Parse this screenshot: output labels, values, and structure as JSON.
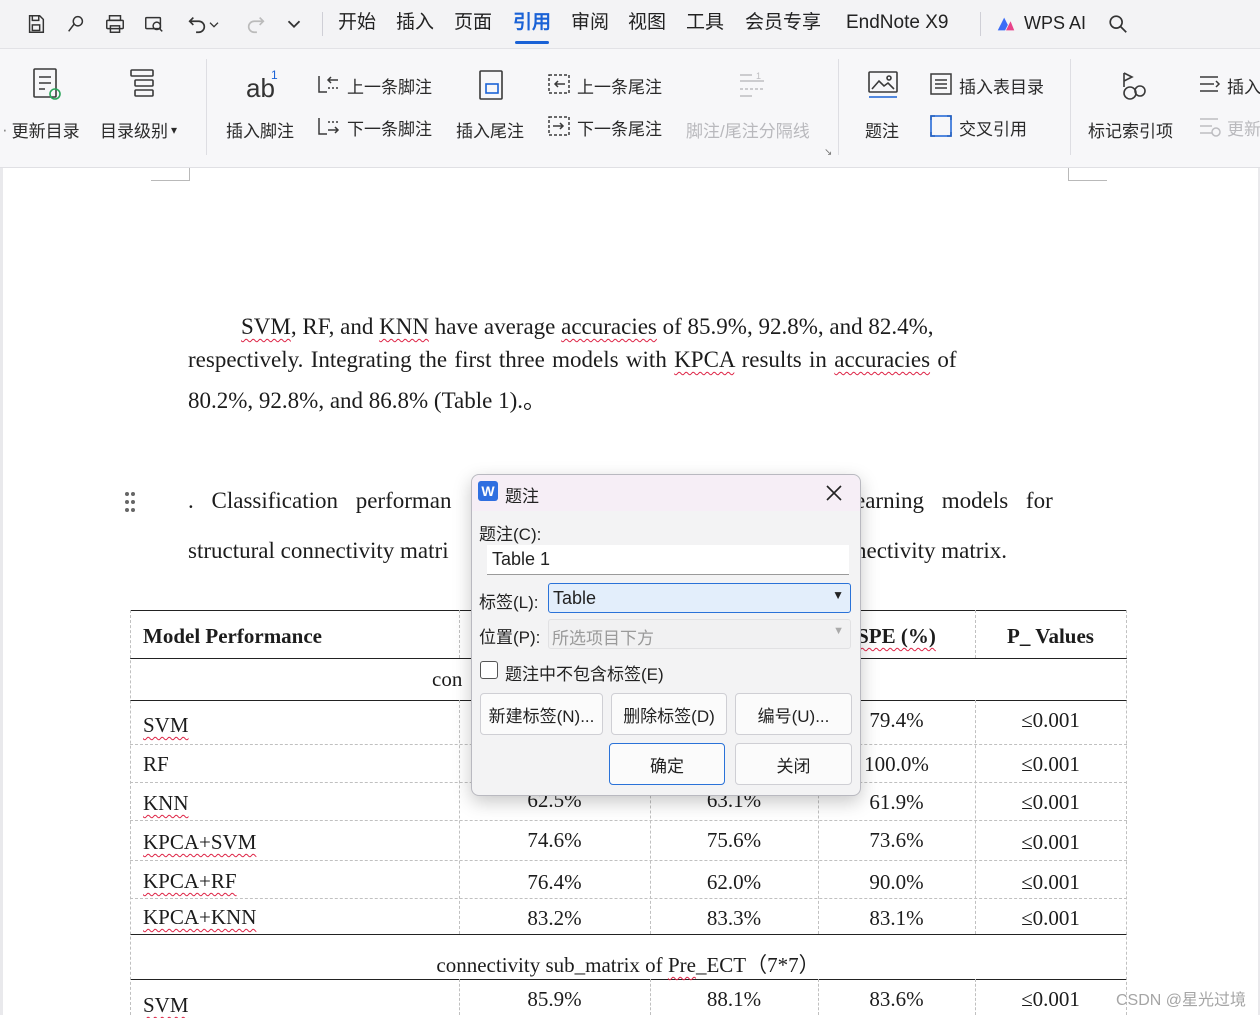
{
  "menu": {
    "tabs": [
      "开始",
      "插入",
      "页面",
      "引用",
      "审阅",
      "视图",
      "工具",
      "会员专享",
      "EndNote X9"
    ],
    "active": "引用",
    "wps_ai": "WPS AI"
  },
  "ribbon": {
    "update_toc": "更新目录",
    "toc_level": "目录级别",
    "insert_footnote": "插入脚注",
    "prev_footnote": "上一条脚注",
    "next_footnote": "下一条脚注",
    "insert_endnote": "插入尾注",
    "prev_endnote": "上一条尾注",
    "next_endnote": "下一条尾注",
    "separator": "脚注/尾注分隔线",
    "caption": "题注",
    "insert_table_toc": "插入表目录",
    "cross_ref": "交叉引用",
    "mark_index": "标记索引项",
    "insert_partial": "插入",
    "update_partial": "更新"
  },
  "document": {
    "para1_line1": [
      "SVM",
      ", RF, and ",
      "KNN",
      " have average ",
      "accuracies",
      " of 85.9%, 92.8%, and 82.4%,"
    ],
    "para1_line2": [
      "respectively. Integrating the first three models with ",
      "KPCA",
      " results in ",
      "accuracies",
      " of"
    ],
    "para1_line3": "80.2%, 92.8%, and 86.8% (Table 1).。",
    "caption_left1": ". Classification performan",
    "caption_right1": "earning models for",
    "caption_left2": "structural connectivity matri",
    "caption_right2": "nectivity matrix."
  },
  "table": {
    "headers": [
      "Model Performance",
      "SPE (%)",
      "P_ Values"
    ],
    "section1_partial": "con",
    "rows": [
      {
        "model": "SVM",
        "acc": "",
        "sen": "",
        "spe": "79.4%",
        "p": "≤0.001"
      },
      {
        "model": "RF",
        "acc": "",
        "sen": "",
        "spe": "100.0%",
        "p": "≤0.001"
      },
      {
        "model": "KNN",
        "acc": "62.5%",
        "sen": "63.1%",
        "spe": "61.9%",
        "p": "≤0.001"
      },
      {
        "model": "KPCA+SVM",
        "acc": "74.6%",
        "sen": "75.6%",
        "spe": "73.6%",
        "p": "≤0.001"
      },
      {
        "model": "KPCA+RF",
        "acc": "76.4%",
        "sen": "62.0%",
        "spe": "90.0%",
        "p": "≤0.001"
      },
      {
        "model": "KPCA+KNN",
        "acc": "83.2%",
        "sen": "83.3%",
        "spe": "83.1%",
        "p": "≤0.001"
      }
    ],
    "section2_prefix": "connectivity sub_matrix of ",
    "section2_word": "Pre",
    "section2_suffix": "_ECT（7*7）",
    "last_row": {
      "model": "SVM",
      "acc": "85.9%",
      "sen": "88.1%",
      "spe": "83.6%",
      "p": "≤0.001"
    }
  },
  "dialog": {
    "title": "题注",
    "caption_label": "题注(C):",
    "caption_value": "Table 1",
    "label_label": "标签(L):",
    "label_value": "Table",
    "position_label": "位置(P):",
    "position_value": "所选项目下方",
    "exclude_label": "题注中不包含标签(E)",
    "new_label": "新建标签(N)...",
    "delete_label": "删除标签(D)",
    "numbering": "编号(U)...",
    "ok": "确定",
    "close": "关闭"
  },
  "watermark": "CSDN @星光过境"
}
